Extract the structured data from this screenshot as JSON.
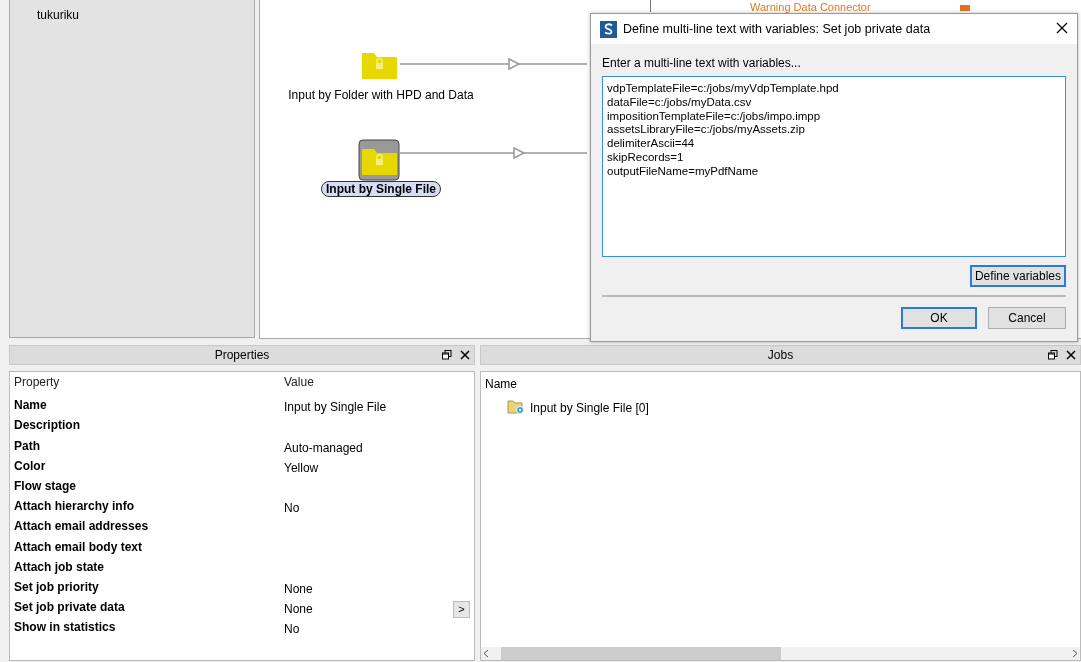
{
  "sidebar": {
    "items": [
      {
        "label": "tukuriku"
      }
    ]
  },
  "canvas": {
    "partial_label": "Warning Data Connector",
    "nodes": [
      {
        "label": "Input by Folder with HPD and Data",
        "selected": false
      },
      {
        "label": "Input by Single File",
        "selected": true
      }
    ]
  },
  "dialog": {
    "title": "Define multi-line text with variables: Set job private data",
    "prompt": "Enter a multi-line text with variables...",
    "text_lines": [
      "vdpTemplateFile=c:/jobs/myVdpTemplate.hpd",
      "dataFile=c:/jobs/myData.csv",
      "impositionTemplateFile=c:/jobs/impo.impp",
      "assetsLibraryFile=c:/jobs/myAssets.zip",
      "delimiterAscii=44",
      "skipRecords=1",
      "outputFileName=myPdfName"
    ],
    "define_button": "Define variables",
    "ok_button": "OK",
    "cancel_button": "Cancel"
  },
  "properties": {
    "title": "Properties",
    "columns": [
      "Property",
      "Value"
    ],
    "rows": [
      {
        "name": "Name",
        "value": "Input by Single File"
      },
      {
        "name": "Description",
        "value": ""
      },
      {
        "name": "Path",
        "value": "Auto-managed"
      },
      {
        "name": "Color",
        "value": "Yellow"
      },
      {
        "name": "Flow stage",
        "value": ""
      },
      {
        "name": "Attach hierarchy info",
        "value": "No"
      },
      {
        "name": "Attach email addresses",
        "value": ""
      },
      {
        "name": "Attach email body text",
        "value": ""
      },
      {
        "name": "Attach job state",
        "value": ""
      },
      {
        "name": "Set job priority",
        "value": "None"
      },
      {
        "name": "Set job private data",
        "value": "None",
        "button": ">"
      },
      {
        "name": "Show in statistics",
        "value": "No"
      }
    ]
  },
  "jobs": {
    "title": "Jobs",
    "column": "Name",
    "items": [
      {
        "label": "Input by Single File [0]"
      }
    ]
  }
}
